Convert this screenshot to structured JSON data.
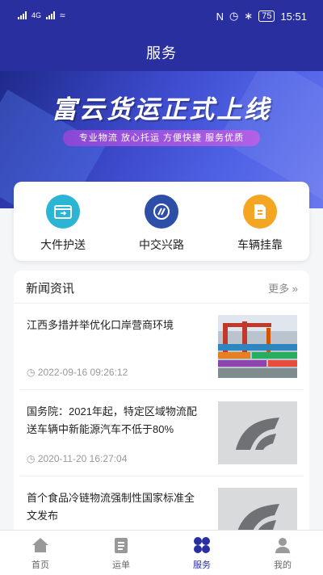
{
  "status_bar": {
    "time": "15:51",
    "battery": "75",
    "network": "4G"
  },
  "header": {
    "title": "服务"
  },
  "banner": {
    "headline": "富云货运正式上线",
    "tagline": "专业物流 放心托运 方便快捷 服务优质"
  },
  "services": [
    {
      "label": "大件护送"
    },
    {
      "label": "中交兴路"
    },
    {
      "label": "车辆挂靠"
    }
  ],
  "news": {
    "heading": "新闻资讯",
    "more": "更多",
    "items": [
      {
        "title": "江西多措并举优化口岸营商环境",
        "date": "2022-09-16 09:26:12"
      },
      {
        "title": "国务院：2021年起，特定区域物流配送车辆中新能源汽车不低于80%",
        "date": "2020-11-20 16:27:04"
      },
      {
        "title": "首个食品冷链物流强制性国家标准全文发布",
        "date": ""
      }
    ]
  },
  "tabbar": {
    "items": [
      {
        "label": "首页"
      },
      {
        "label": "运单"
      },
      {
        "label": "服务"
      },
      {
        "label": "我的"
      }
    ],
    "active_index": 2
  },
  "colors": {
    "primary": "#2a2f9f",
    "teal": "#2bb4d4",
    "orange": "#f4a623"
  }
}
